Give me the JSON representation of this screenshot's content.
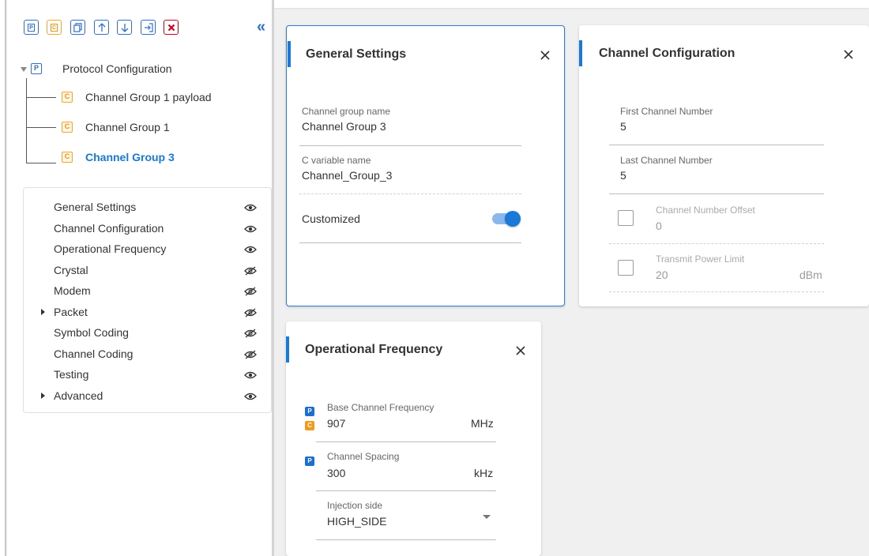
{
  "toolbar": {
    "buttons": [
      {
        "icon": "add-protocol-icon",
        "glyph": "P"
      },
      {
        "icon": "add-channel-group-icon",
        "glyph": "C"
      },
      {
        "icon": "copy-icon"
      },
      {
        "icon": "move-up-icon"
      },
      {
        "icon": "move-down-icon"
      },
      {
        "icon": "export-icon"
      },
      {
        "icon": "delete-icon"
      }
    ],
    "collapse_glyph": "«"
  },
  "tree": {
    "root": {
      "badge": "P",
      "label": "Protocol Configuration"
    },
    "children": [
      {
        "badge": "C",
        "label": "Channel Group 1 payload"
      },
      {
        "badge": "C",
        "label": "Channel Group 1"
      },
      {
        "badge": "C",
        "label": "Channel Group 3",
        "selected": true
      }
    ]
  },
  "visibility": {
    "items": [
      {
        "label": "General Settings",
        "visible": true
      },
      {
        "label": "Channel Configuration",
        "visible": true
      },
      {
        "label": "Operational Frequency",
        "visible": true
      },
      {
        "label": "Crystal",
        "visible": false
      },
      {
        "label": "Modem",
        "visible": false
      },
      {
        "label": "Packet",
        "visible": false,
        "expandable": true
      },
      {
        "label": "Symbol Coding",
        "visible": false
      },
      {
        "label": "Channel Coding",
        "visible": false
      },
      {
        "label": "Testing",
        "visible": true
      },
      {
        "label": "Advanced",
        "visible": true,
        "expandable": true
      }
    ]
  },
  "general": {
    "title": "General Settings",
    "group_name_label": "Channel group name",
    "group_name_value": "Channel Group 3",
    "cvar_label": "C variable name",
    "cvar_value": "Channel_Group_3",
    "customized_label": "Customized",
    "customized_on": true
  },
  "channel": {
    "title": "Channel Configuration",
    "first_label": "First Channel Number",
    "first_value": "5",
    "last_label": "Last Channel Number",
    "last_value": "5",
    "offset_label": "Channel Number Offset",
    "offset_value": "0",
    "offset_checked": false,
    "power_label": "Transmit Power Limit",
    "power_value": "20",
    "power_unit": "dBm",
    "power_checked": false
  },
  "opfreq": {
    "title": "Operational Frequency",
    "base_label": "Base Channel Frequency",
    "base_value": "907",
    "base_unit": "MHz",
    "spacing_label": "Channel Spacing",
    "spacing_value": "300",
    "spacing_unit": "kHz",
    "inject_label": "Injection side",
    "inject_value": "HIGH_SIDE",
    "badge_p": "P",
    "badge_c": "C"
  },
  "colors": {
    "accent": "#1979d8",
    "protocol_badge": "#2e6fd1",
    "channel_badge": "#f5a623",
    "delete": "#d0021b"
  }
}
